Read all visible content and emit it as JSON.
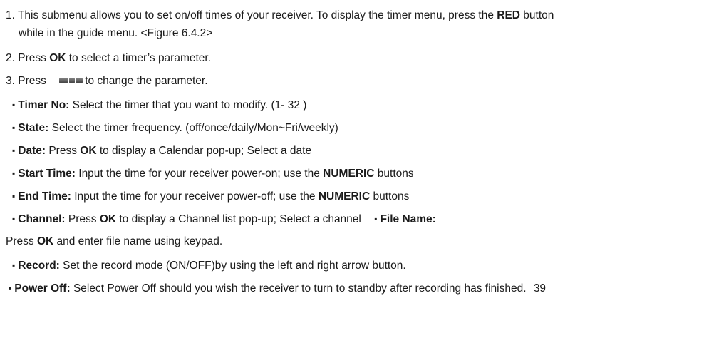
{
  "items": [
    {
      "num": "1.",
      "pre": "This submenu allows you to set on/off times of your receiver. To display the timer menu, press the ",
      "bold": "RED",
      "post": " button"
    },
    {
      "num": "2.",
      "pre": "Press ",
      "bold": "OK",
      "post": " to select a timer’s parameter."
    },
    {
      "num": "3.",
      "pre": "Press",
      "post": "to change the parameter."
    }
  ],
  "item1_cont": "while in the guide menu. <Figure 6.4.2>",
  "bullet_char": "▪",
  "bullets": {
    "timer_no": {
      "label": "Timer No:",
      "text": " Select the timer that you want to modify. (1- 32 )"
    },
    "state": {
      "label": "State:",
      "text": " Select the timer frequency. (off/once/daily/Mon~Fri/weekly)"
    },
    "date": {
      "label": "Date:",
      "pre": " Press ",
      "bold": "OK",
      "post": " to display a Calendar pop-up; Select a date"
    },
    "start_time": {
      "label": "Start Time:",
      "pre": " Input the time for your receiver power-on; use the ",
      "bold": "NUMERIC",
      "post": " buttons"
    },
    "end_time": {
      "label": "End Time:",
      "pre": " Input the time for your receiver power-off; use the ",
      "bold": "NUMERIC",
      "post": " buttons"
    },
    "channel": {
      "label": "Channel:",
      "pre": " Press ",
      "bold": "OK",
      "post": " to display a Channel list pop-up; Select a channel",
      "file_label": "File Name:"
    },
    "file_name_cont": {
      "pre": "Press ",
      "bold": "OK",
      "post": " and enter file name using keypad."
    },
    "record": {
      "label": "Record:",
      "text": " Set the record mode (ON/OFF)by using the left and right arrow button."
    },
    "power_off": {
      "label": "Power Off:",
      "text": " Select Power Off should you wish the receiver to turn to standby  after recording has finished."
    }
  },
  "page_number": "39",
  "icons": [
    "remote-arrow-buttons-icon"
  ]
}
